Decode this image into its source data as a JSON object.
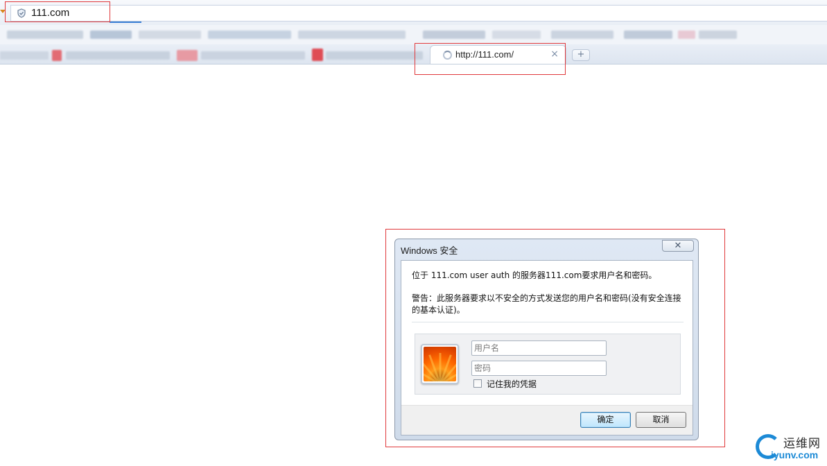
{
  "browser": {
    "address_bar": {
      "url": "111.com",
      "security_icon": "shield-check-icon"
    },
    "active_tab": {
      "title": "http://111.com/",
      "status_icon": "loading-spinner-icon",
      "close_label": "×"
    },
    "new_tab_label": "+"
  },
  "dialog": {
    "title": "Windows 安全",
    "close_label": "✕",
    "message": "位于 111.com user auth 的服务器111.com要求用户名和密码。",
    "warning": "警告：此服务器要求以不安全的方式发送您的用户名和密码(没有安全连接的基本认证)。",
    "username_placeholder": "用户名",
    "password_placeholder": "密码",
    "remember_label": "记住我的凭据",
    "remember_checked": false,
    "ok_label": "确定",
    "cancel_label": "取消"
  },
  "watermark": {
    "cn": "运维网",
    "en": "iyunv.com"
  },
  "colors": {
    "highlight_box": "#e0383b",
    "accent": "#1c8ad6"
  }
}
